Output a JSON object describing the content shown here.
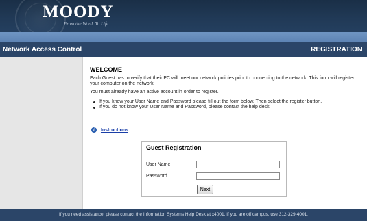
{
  "header": {
    "logo_title": "MOODY",
    "logo_tagline": "From the Word. To Life."
  },
  "title_bar": {
    "left": "Network Access Control",
    "right": "REGISTRATION"
  },
  "main": {
    "welcome": "WELCOME",
    "paragraph1": "Each Guest has to verify that their PC will meet our network policies prior to connecting to the network. This form will register your computer on the network.",
    "paragraph2": "You must already have an active account in order to register.",
    "bullets": [
      "If you know your User Name and Password please fill out the form below. Then select the register button.",
      "If you do not know your User Name and Password, please contact the help desk."
    ],
    "instructions_link": "Instructions",
    "info_icon": "i"
  },
  "guest_form": {
    "title": "Guest Registration",
    "username_label": "User Name",
    "username_value": "",
    "password_label": "Password",
    "password_value": "",
    "next_button": "Next"
  },
  "footer": {
    "text": "If you need assistance, please contact the Information Systems Help Desk at x4001. If you are off campus, use 312-329-4001."
  },
  "colors": {
    "header_bg": "#1a2f47",
    "band": "#6f95c3",
    "title_bar_bg": "#2b4568",
    "sidebar_bg": "#e6e6e6",
    "link": "#1a3fa8"
  }
}
